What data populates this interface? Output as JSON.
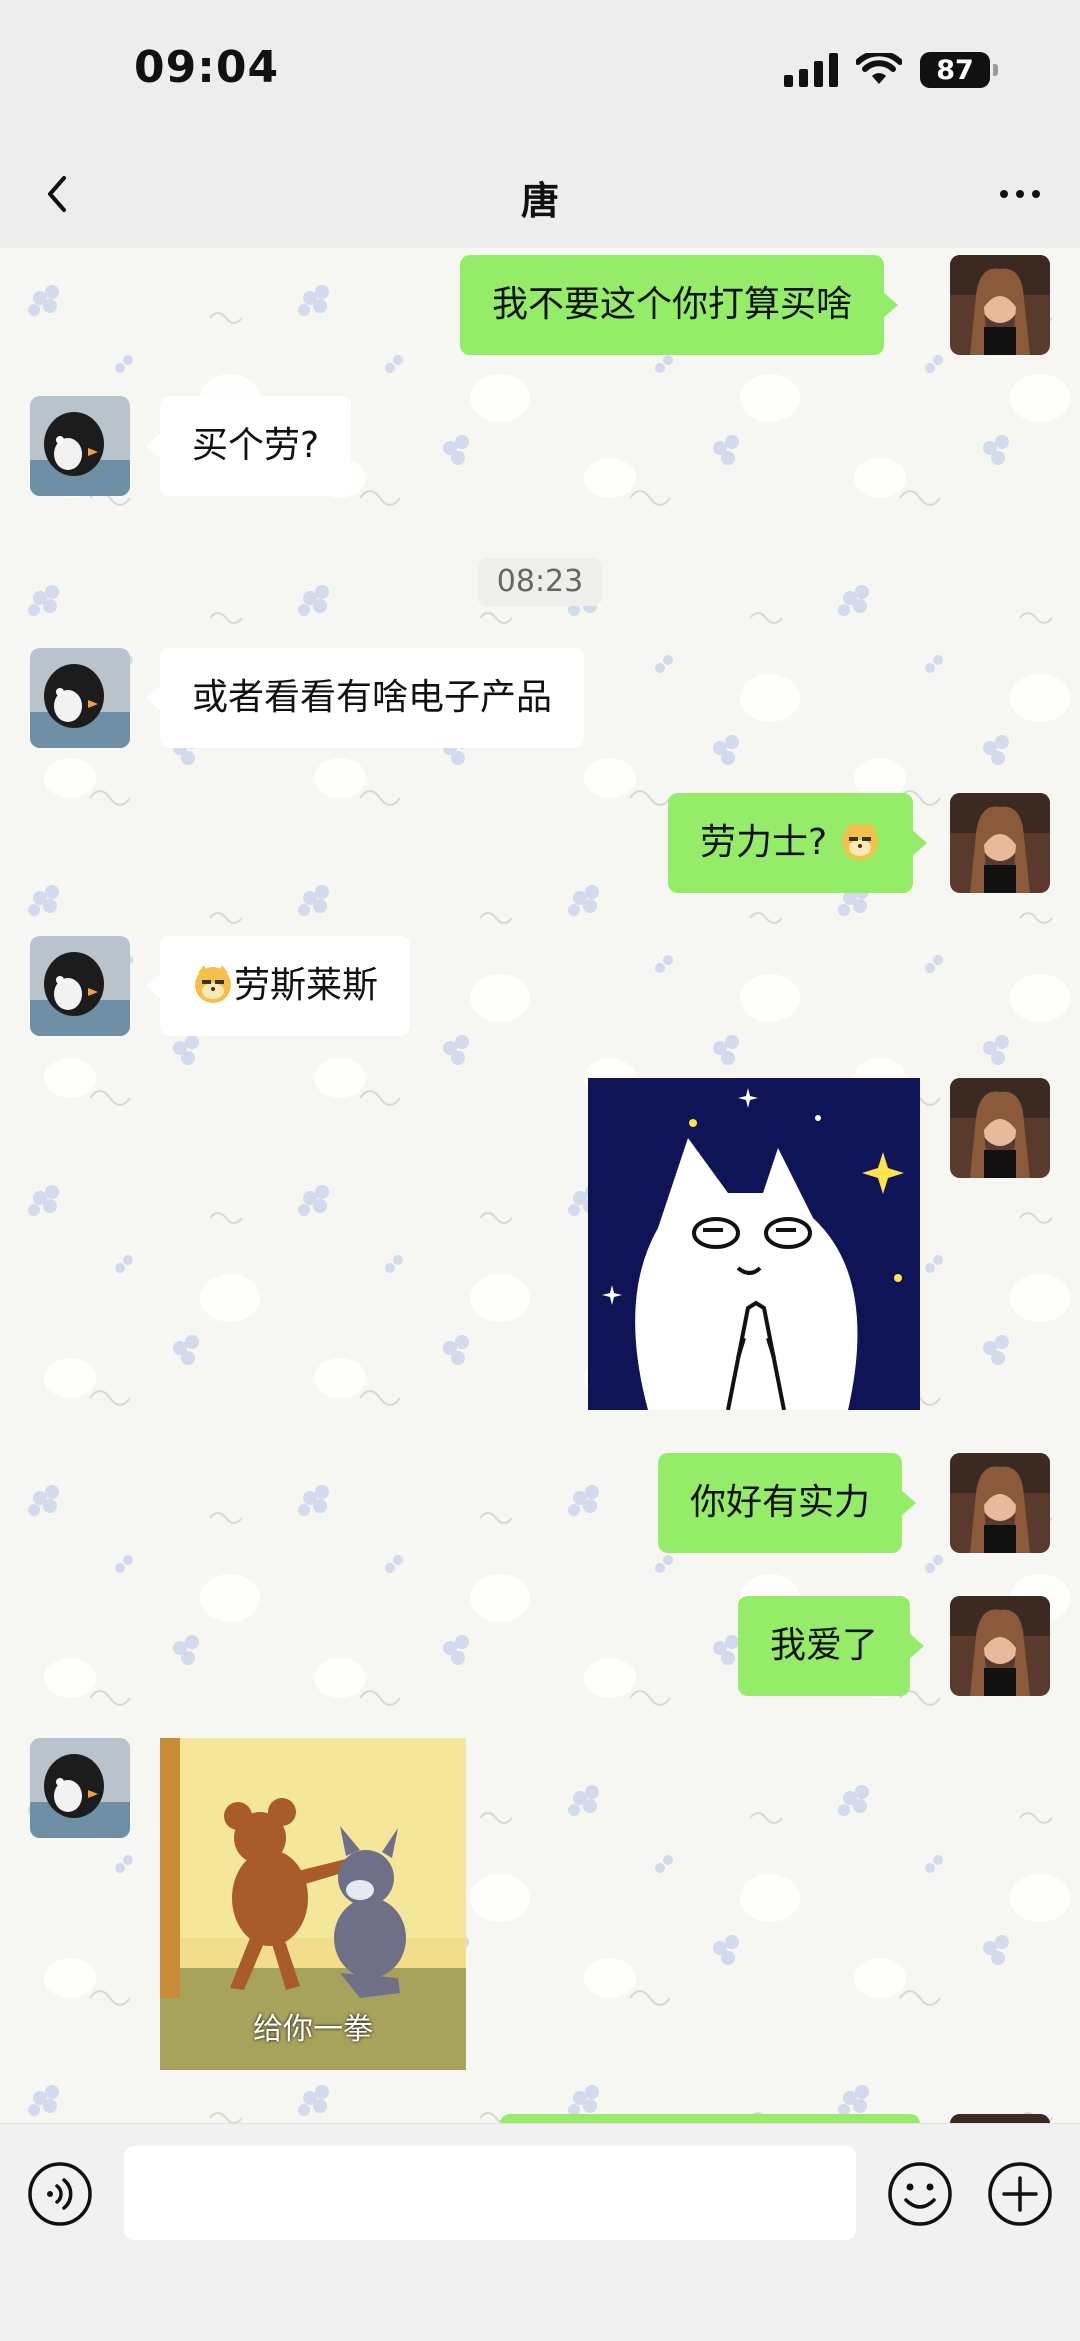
{
  "status_bar": {
    "time": "09:04",
    "battery": "87"
  },
  "header": {
    "title": "唐"
  },
  "messages": {
    "m1_text": "我不要这个你打算买啥",
    "m2_text": "买个劳?",
    "timestamp": "08:23",
    "m3_text": "或者看看有啥电子产品",
    "m4_text": "劳力士?",
    "m5_text": "劳斯莱斯",
    "m7_text": "你好有实力",
    "m8_text": "我爱了",
    "m9_caption": "给你一拳"
  },
  "input": {
    "placeholder": ""
  },
  "colors": {
    "outgoing_bubble": "#95ec69",
    "incoming_bubble": "#ffffff",
    "header_bg": "#ededed"
  }
}
